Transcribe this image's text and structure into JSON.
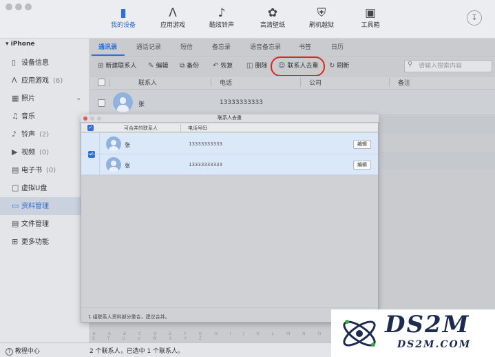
{
  "toolbar_nav": [
    {
      "label": "我的设备",
      "icon": "phone-icon"
    },
    {
      "label": "应用游戏",
      "icon": "app-store-icon"
    },
    {
      "label": "酷炫铃声",
      "icon": "music-note-icon"
    },
    {
      "label": "高清壁纸",
      "icon": "flower-icon"
    },
    {
      "label": "刷机越狱",
      "icon": "shield-icon"
    },
    {
      "label": "工具箱",
      "icon": "toolbox-icon"
    }
  ],
  "sidebar": {
    "device": "iPhone",
    "items": [
      {
        "label": "设备信息",
        "count": ""
      },
      {
        "label": "应用游戏",
        "count": "(6)"
      },
      {
        "label": "照片",
        "count": ""
      },
      {
        "label": "音乐",
        "count": ""
      },
      {
        "label": "铃声",
        "count": "(2)"
      },
      {
        "label": "视频",
        "count": "(0)"
      },
      {
        "label": "电子书",
        "count": "(0)"
      },
      {
        "label": "虚拟U盘",
        "count": ""
      },
      {
        "label": "资料管理",
        "count": ""
      },
      {
        "label": "文件管理",
        "count": ""
      },
      {
        "label": "更多功能",
        "count": ""
      }
    ],
    "help": "教程中心"
  },
  "tabs": [
    "通讯录",
    "通话记录",
    "短信",
    "备忘录",
    "语音备忘录",
    "书签",
    "日历"
  ],
  "actions": {
    "new_contact": "新建联系人",
    "edit": "编辑",
    "backup": "备份",
    "restore": "恢复",
    "delete": "删除",
    "dedupe": "联系人去重",
    "refresh": "刷新",
    "search_placeholder": "请输入搜索内容"
  },
  "table": {
    "headers": [
      "联系人",
      "电话",
      "公司",
      "备注"
    ],
    "rows": [
      {
        "name": "张",
        "phone": "13333333333"
      }
    ]
  },
  "dialog": {
    "title": "联系人去重",
    "col_contacts": "可合并的联系人",
    "col_phone": "电话号码",
    "rows": [
      {
        "name": "张",
        "phone": "13333333333",
        "edit": "编辑"
      },
      {
        "name": "张",
        "phone": "13333333333",
        "edit": "编辑"
      }
    ],
    "footer": "1 组联系人资料部分重合，建议合并。"
  },
  "alphabet": "# A B C D E F G H I J K L M N O P Q R S T U V W X Y Z",
  "status": "2 个联系人，已选中 1 个联系人。",
  "watermark": {
    "brand": "DS2M",
    "url": "DS2M.COM"
  },
  "colors": {
    "accent": "#2f6fd6",
    "highlight": "#e0251b"
  }
}
